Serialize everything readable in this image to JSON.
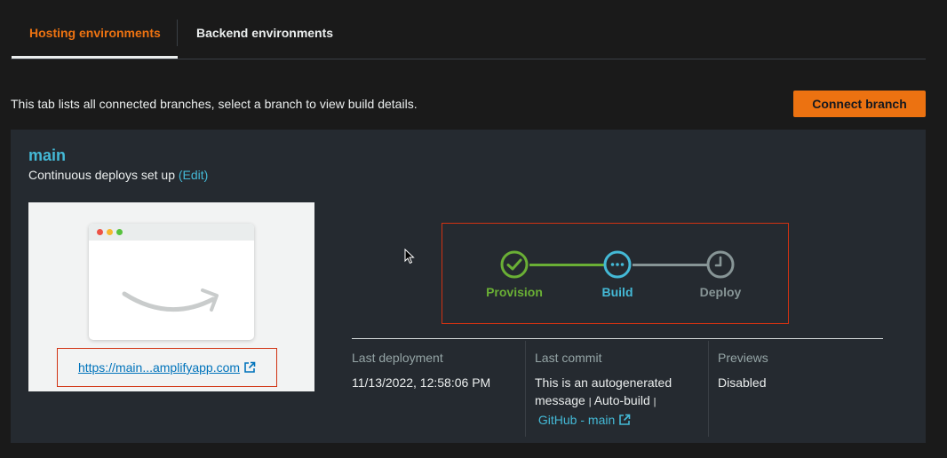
{
  "tabs": [
    {
      "label": "Hosting environments",
      "active": true
    },
    {
      "label": "Backend environments",
      "active": false
    }
  ],
  "intro_text": "This tab lists all connected branches, select a branch to view build details.",
  "connect_button": "Connect branch",
  "branch": {
    "name": "main",
    "deploy_text": "Continuous deploys set up",
    "edit_link": "(Edit)",
    "site_url": "https://main...amplifyapp.com"
  },
  "pipeline": {
    "stages": [
      {
        "label": "Provision",
        "status": "completed",
        "color": "#6aaf35"
      },
      {
        "label": "Build",
        "status": "in-progress",
        "color": "#44b9d6"
      },
      {
        "label": "Deploy",
        "status": "pending",
        "color": "#879596"
      }
    ]
  },
  "meta": {
    "last_deployment": {
      "label": "Last deployment",
      "value": "11/13/2022, 12:58:06 PM"
    },
    "last_commit": {
      "label": "Last commit",
      "line1": "This is an autogenerated",
      "line2": "message",
      "sep1": "|",
      "line2b": "Auto-build",
      "sep2": "|",
      "link": "GitHub - main"
    },
    "previews": {
      "label": "Previews",
      "value": "Disabled"
    }
  },
  "colors": {
    "accent": "#ec7211",
    "link": "#44b9d6",
    "highlight_border": "#d13212"
  }
}
